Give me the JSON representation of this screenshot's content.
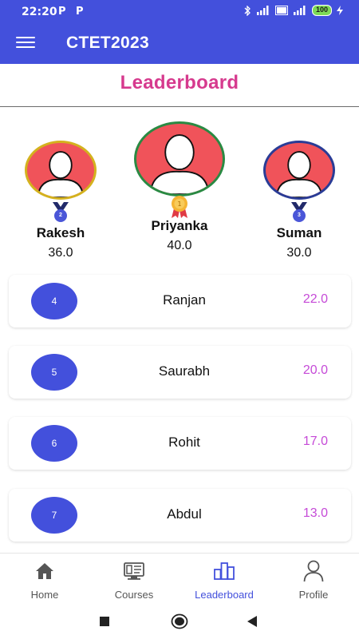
{
  "status_bar": {
    "time": "22:20",
    "notif_icons": [
      "P",
      "P"
    ],
    "battery": "100"
  },
  "app_bar": {
    "title": "CTET2023"
  },
  "page": {
    "heading": "Leaderboard"
  },
  "podium": [
    {
      "rank": "2",
      "name": "Rakesh",
      "score": "36.0",
      "ring_color": "#d4b21e"
    },
    {
      "rank": "1",
      "name": "Priyanka",
      "score": "40.0",
      "ring_color": "#2a8a43"
    },
    {
      "rank": "3",
      "name": "Suman",
      "score": "30.0",
      "ring_color": "#2a3c96"
    }
  ],
  "leaderboard": [
    {
      "rank": "4",
      "name": "Ranjan",
      "score": "22.0"
    },
    {
      "rank": "5",
      "name": "Saurabh",
      "score": "20.0"
    },
    {
      "rank": "6",
      "name": "Rohit",
      "score": "17.0"
    },
    {
      "rank": "7",
      "name": "Abdul",
      "score": "13.0"
    }
  ],
  "bottom_nav": [
    {
      "label": "Home",
      "icon": "home-icon"
    },
    {
      "label": "Courses",
      "icon": "courses-icon"
    },
    {
      "label": "Leaderboard",
      "icon": "leaderboard-icon",
      "active": true
    },
    {
      "label": "Profile",
      "icon": "profile-icon"
    }
  ],
  "colors": {
    "primary": "#4350dc",
    "heading": "#d63a8e",
    "score": "#c54ad7",
    "avatar": "#f0535a"
  }
}
